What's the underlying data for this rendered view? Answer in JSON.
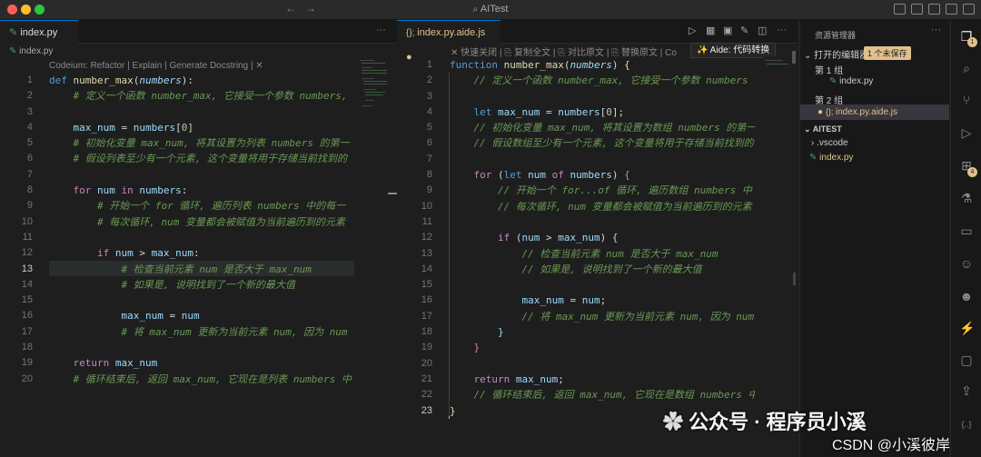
{
  "window": {
    "title": "AITest"
  },
  "left_editor": {
    "tab_label": "index.py",
    "breadcrumb": "index.py",
    "codelens": "Codeium: Refactor | Explain | Generate Docstring | ✕",
    "line_numbers": [
      "1",
      "2",
      "3",
      "4",
      "5",
      "6",
      "7",
      "8",
      "9",
      "10",
      "11",
      "12",
      "13",
      "14",
      "15",
      "16",
      "17",
      "18",
      "19",
      "20"
    ]
  },
  "right_editor": {
    "tab_label": "index.py.aide.js",
    "toolbar_items": [
      "✕ 快速关闭",
      "复制全文",
      "对比原文",
      "替换原文",
      "Co"
    ],
    "aide_button": "✨ Aide: 代码转换",
    "line_numbers": [
      "1",
      "2",
      "3",
      "4",
      "5",
      "6",
      "7",
      "8",
      "9",
      "10",
      "11",
      "12",
      "13",
      "14",
      "15",
      "16",
      "17",
      "18",
      "19",
      "20",
      "21",
      "22",
      "23"
    ]
  },
  "sidebar": {
    "header": "资源管理器",
    "open_editors": "打开的编辑器",
    "unsaved_badge": "1 个未保存",
    "group1": "第 1 组",
    "group1_file": "index.py",
    "group2": "第 2 组",
    "group2_file": "index.py.aide.js",
    "workspace": "AITEST",
    "folder": ".vscode",
    "file": "index.py"
  },
  "activity_bar": {
    "extensions_badge": "4"
  },
  "watermark": {
    "channel": "公众号 · 程序员小溪",
    "source": "CSDN @小溪彼岸"
  },
  "colors": {
    "accent": "#0078d4",
    "badge": "#e2c08d",
    "modified": "#e2c08d"
  }
}
